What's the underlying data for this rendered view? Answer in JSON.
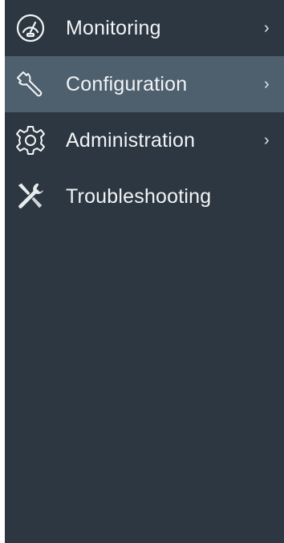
{
  "theme": {
    "sidebar_bg": "#2c3741",
    "active_bg": "#4e5f6d",
    "text_color": "#f2f4f6"
  },
  "nav": {
    "items": [
      {
        "label": "Monitoring",
        "icon": "dashboard-gauge-icon",
        "has_submenu": true,
        "chevron": "›",
        "active": false
      },
      {
        "label": "Configuration",
        "icon": "wrench-icon",
        "has_submenu": true,
        "chevron": "›",
        "active": true
      },
      {
        "label": "Administration",
        "icon": "gear-icon",
        "has_submenu": true,
        "chevron": "›",
        "active": false
      },
      {
        "label": "Troubleshooting",
        "icon": "tools-icon",
        "has_submenu": false,
        "active": false
      }
    ]
  }
}
